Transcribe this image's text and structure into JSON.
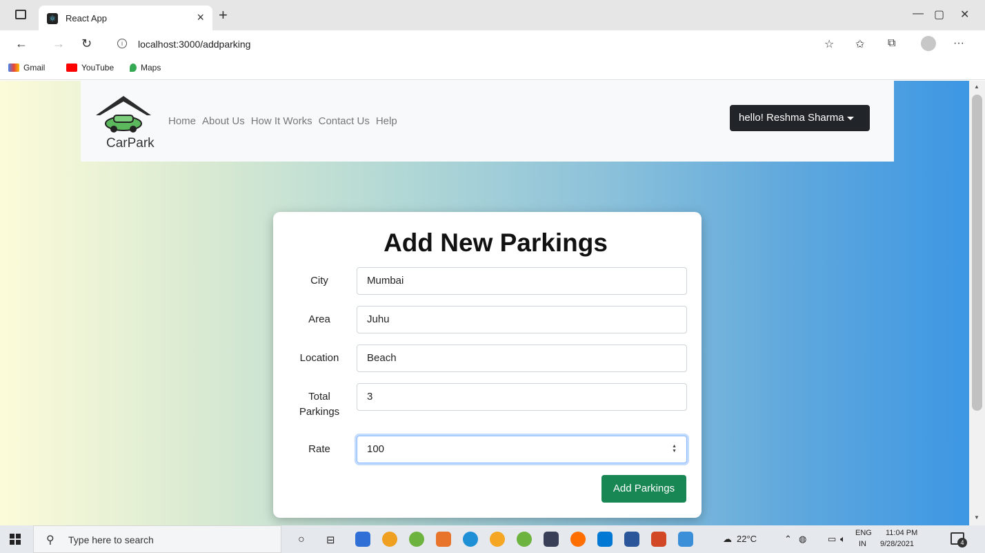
{
  "browser": {
    "tab_title": "React App",
    "tab_close": "×",
    "new_tab": "+",
    "url": "localhost:3000/addparking",
    "bookmarks": [
      "Gmail",
      "YouTube",
      "Maps"
    ],
    "window_controls": [
      "—",
      "▢",
      "✕"
    ]
  },
  "navbar": {
    "logo_text": "CarPark",
    "links": [
      "Home",
      "About Us",
      "How It Works",
      "Contact Us",
      "Help"
    ],
    "user_button": "hello! Reshma Sharma"
  },
  "form": {
    "title": "Add New Parkings",
    "fields": [
      {
        "label": "City",
        "value": "Mumbai"
      },
      {
        "label": "Area",
        "value": "Juhu"
      },
      {
        "label": "Location",
        "value": "Beach"
      },
      {
        "label": "Total Parkings",
        "value": "3"
      },
      {
        "label": "Rate",
        "value": "100"
      }
    ],
    "submit_label": "Add Parkings"
  },
  "taskbar": {
    "search_placeholder": "Type here to search",
    "weather": "22°C",
    "language": "ENG",
    "region": "IN",
    "time": "11:04 PM",
    "date": "9/28/2021",
    "notification_count": "4"
  }
}
